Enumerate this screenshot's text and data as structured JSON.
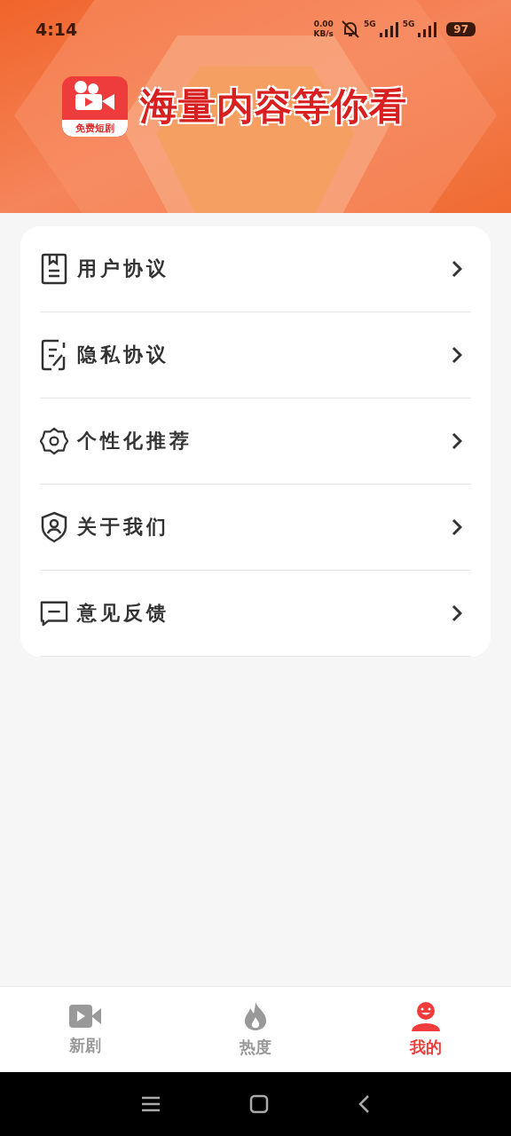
{
  "status_bar": {
    "time": "4:14",
    "speed_value": "0.00",
    "speed_unit": "KB/s",
    "sim_1": "5G",
    "sim_2": "5G",
    "battery": "97"
  },
  "banner": {
    "logo_label": "免费短剧",
    "title": "海量内容等你看"
  },
  "menu": [
    {
      "label": "用户协议"
    },
    {
      "label": "隐私协议"
    },
    {
      "label": "个性化推荐"
    },
    {
      "label": "关于我们"
    },
    {
      "label": "意见反馈"
    }
  ],
  "tabs": [
    {
      "label": "新剧",
      "selected": false
    },
    {
      "label": "热度",
      "selected": false
    },
    {
      "label": "我的",
      "selected": true
    }
  ]
}
